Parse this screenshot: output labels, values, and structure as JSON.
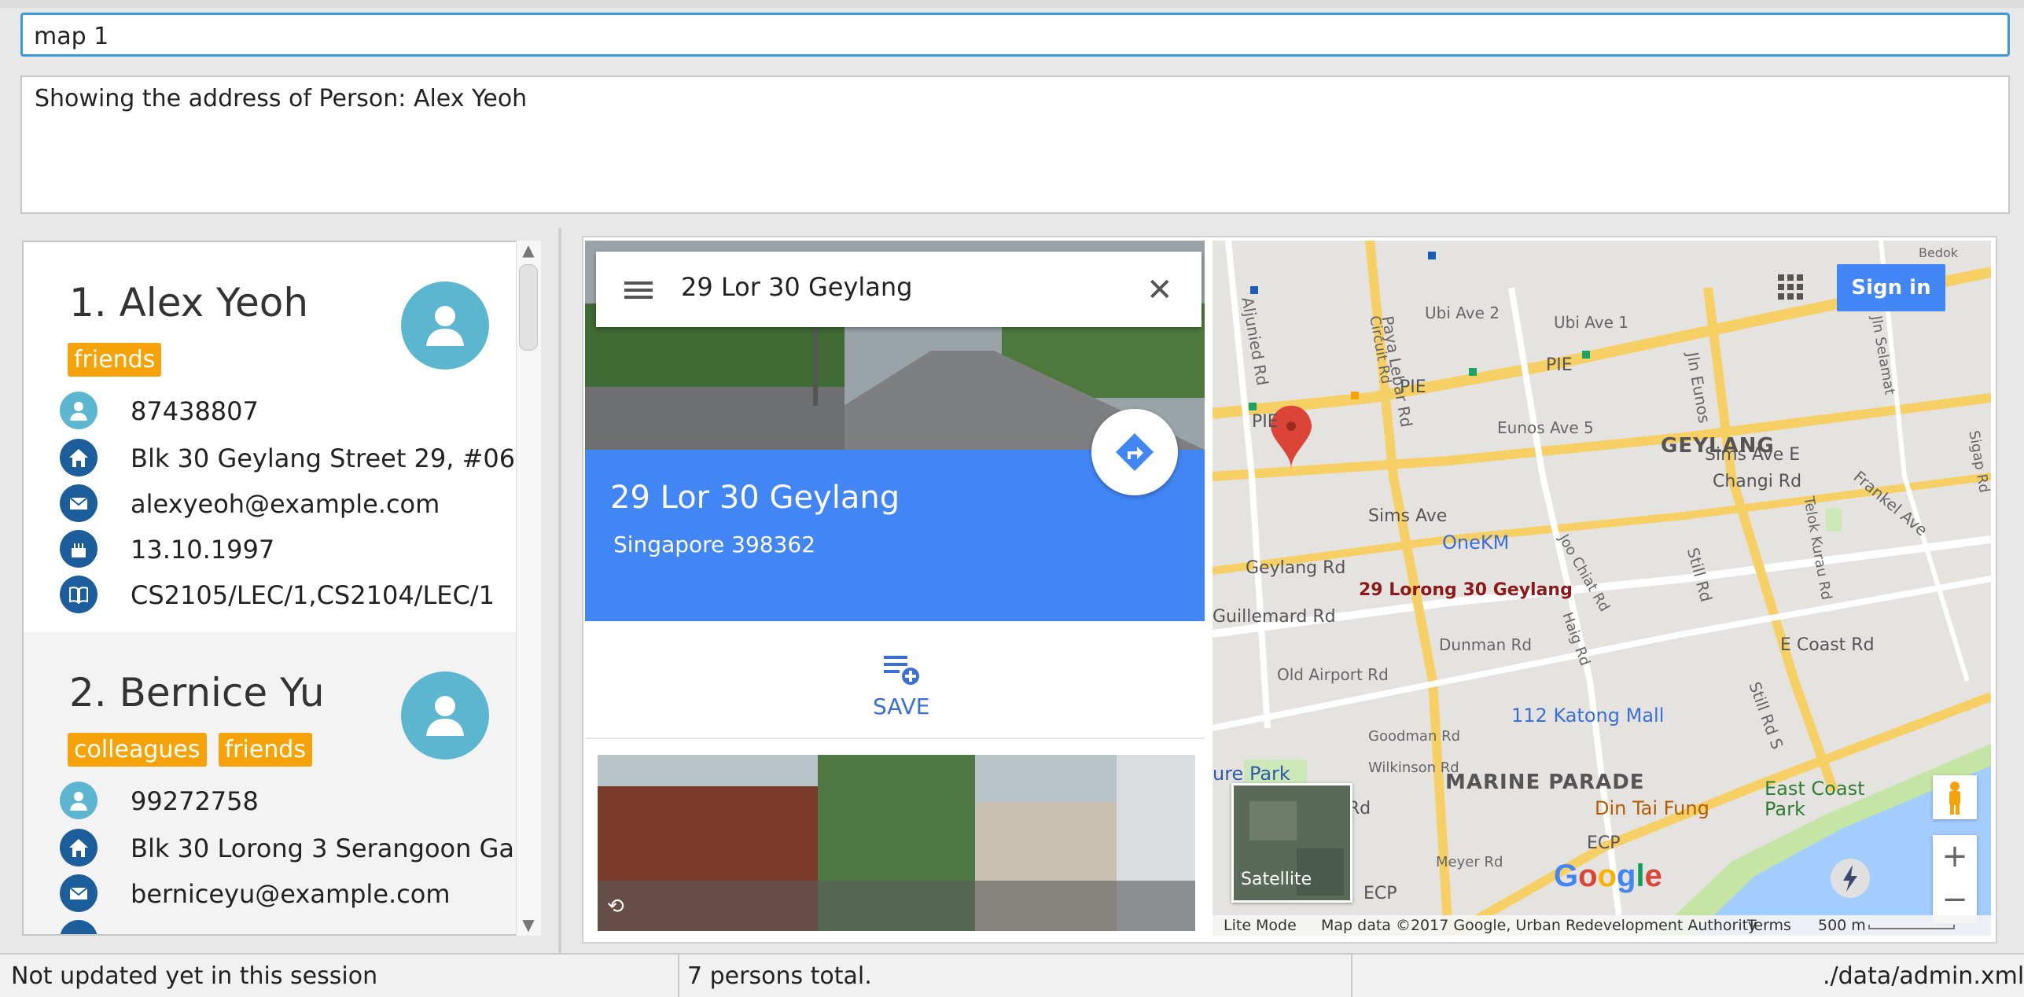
{
  "command_box": {
    "value": "map 1"
  },
  "result_display": {
    "text": "Showing the address of Person: Alex Yeoh"
  },
  "persons": [
    {
      "name": "1. Alex Yeoh",
      "tags": [
        "friends"
      ],
      "phone": "87438807",
      "address": "Blk 30 Geylang Street 29, #06...",
      "email": "alexyeoh@example.com",
      "birthday": "13.10.1997",
      "modules": "CS2105/LEC/1,CS2104/LEC/1"
    },
    {
      "name": "2. Bernice Yu",
      "tags": [
        "colleagues",
        "friends"
      ],
      "phone": "99272758",
      "address": "Blk 30 Lorong 3 Serangoon Ga...",
      "email": "berniceyu@example.com"
    }
  ],
  "map_panel": {
    "search_text": "29 Lor 30 Geylang",
    "place_title": "29 Lor 30 Geylang",
    "place_subtitle": "Singapore 398362",
    "save_label": "SAVE",
    "sign_in_label": "Sign in",
    "satellite_label": "Satellite",
    "marker_label": "29 Lorong 30 Geylang",
    "google_logo": "Google",
    "footer": {
      "lite_mode": "Lite Mode",
      "attribution": "Map data ©2017 Google, Urban Redevelopment Authority",
      "terms": "Terms",
      "scale": "500 m"
    },
    "map_labels": {
      "geylang": "GEYLANG",
      "marine_parade": "MARINE PARADE",
      "pie_1": "PIE",
      "pie_2": "PIE",
      "pie_3": "PIE",
      "ecp_1": "ECP",
      "ecp_2": "ECP",
      "sims_ave": "Sims Ave",
      "sims_ave_e": "Sims Ave E",
      "changi_rd": "Changi Rd",
      "eunos_ave_5": "Eunos Ave 5",
      "ubi_ave_2": "Ubi Ave 2",
      "ubi_ave_1": "Ubi Ave 1",
      "paya_lebar_rd": "Paya Lebar Rd",
      "aljunied_rd": "Aljunied Rd",
      "circuit_rd": "Circuit Rd",
      "jln_eunos": "Jln Eunos",
      "jln_selamat": "Jln Selamat",
      "sigap_rd": "Sigap Rd",
      "frankel_ave": "Frankel Ave",
      "telok_kurau_rd": "Telok Kurau Rd",
      "geylang_rd": "Geylang Rd",
      "guillemard_rd": "Guillemard Rd",
      "onekm": "OneKM",
      "joo_chiat_rd": "Joo Chiat Rd",
      "haig_rd": "Haig Rd",
      "still_rd": "Still Rd",
      "still_rd_s": "Still Rd S",
      "dunman_rd": "Dunman Rd",
      "old_airport_rd": "Old Airport Rd",
      "e_coast_rd": "E Coast Rd",
      "katong_mall": "112 Katong Mall",
      "goodman_rd": "Goodman Rd",
      "wilkinson_rd": "Wilkinson Rd",
      "tanjong_katong": "tatten Rd",
      "din_tai_fung": "Din Tai Fung",
      "east_coast_park": "East Coast Park",
      "meyer_rd": "Meyer Rd",
      "kallang_park": "ure Park",
      "bedok": "Bedok"
    }
  },
  "status_bar": {
    "sync_status": "Not updated yet in this session",
    "total": "7 persons total.",
    "path": "./data/admin.xml"
  },
  "colors": {
    "accent_blue": "#4285f4",
    "tag_orange": "#f6a309",
    "avatar_teal": "#5db6cf",
    "icon_dark_blue": "#1b5e9b",
    "command_border": "#3a9ad9"
  }
}
